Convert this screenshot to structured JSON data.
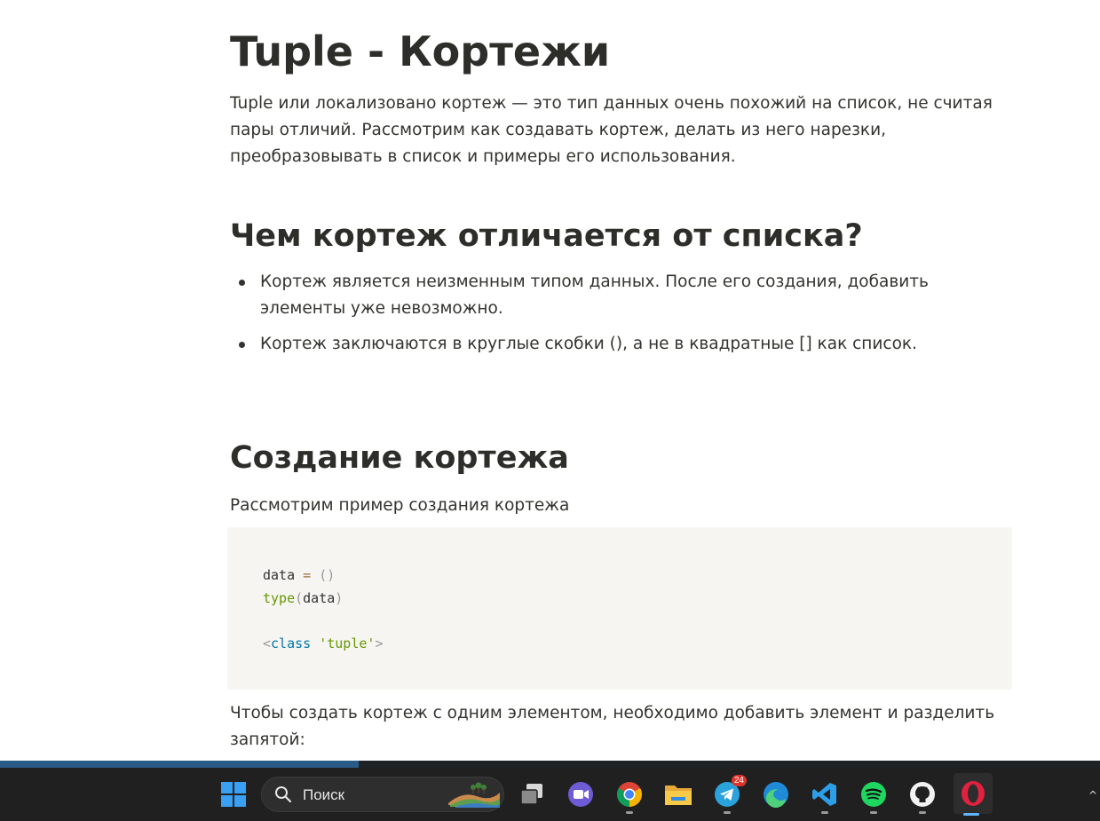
{
  "article": {
    "title": "Tuple - Кортежи",
    "intro": "Tuple или локализовано кортеж — это тип данных очень похожий на список, не считая пары отличий. Рассмотрим как создавать кортеж, делать из него нарезки, преобразовывать в список и примеры его использования.",
    "section1": {
      "heading": "Чем кортеж отличается от списка?",
      "bullets": [
        "Кортеж является неизменным типом данных. После его создания, добавить элементы уже невозможно.",
        "Кортеж заключаются в круглые скобки (), а не в квадратные [] как список."
      ]
    },
    "section2": {
      "heading": "Создание кортежа",
      "lead": "Рассмотрим пример создания кортежа",
      "code": {
        "l1_var": "data",
        "l1_op": "=",
        "l1_val": "()",
        "l2_fn": "type",
        "l2_open": "(",
        "l2_arg": "data",
        "l2_close": ")",
        "l3_lt": "<",
        "l3_kw": "class",
        "l3_str": "'tuple'",
        "l3_gt": ">"
      },
      "after": "Чтобы создать кортеж с одним элементом, необходимо добавить элемент и разделить запятой:"
    }
  },
  "reading_progress": 0.326,
  "taskbar": {
    "search_placeholder": "Поиск",
    "apps": [
      "start-icon",
      "task-view-icon",
      "video-meet-icon",
      "chrome-icon",
      "file-explorer-icon",
      "telegram-icon",
      "edge-icon",
      "vscode-icon",
      "spotify-icon",
      "github-icon",
      "opera-icon"
    ],
    "telegram_badge": "24",
    "tray_chevron": "^"
  },
  "colors": {
    "text": "#33332f",
    "code_bg": "#f6f5f1",
    "progress": "#2a5a86",
    "taskbar": "#202020"
  }
}
